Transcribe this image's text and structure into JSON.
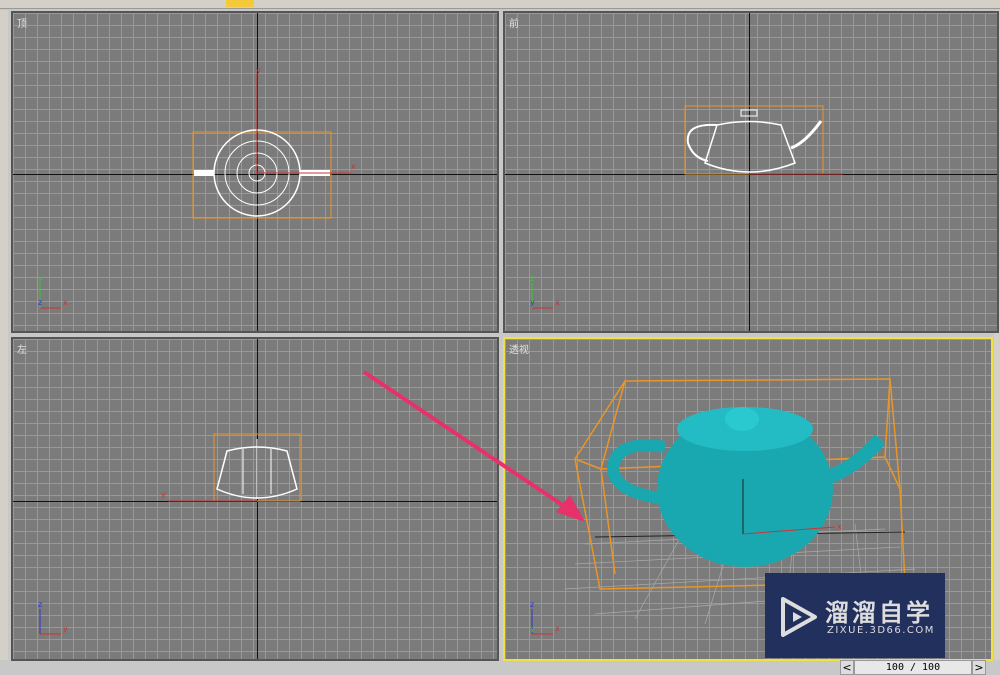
{
  "viewports": [
    {
      "label": "顶"
    },
    {
      "label": "前"
    },
    {
      "label": "左"
    },
    {
      "label": "透视"
    }
  ],
  "axes": {
    "x": "x",
    "y": "y",
    "z": "z"
  },
  "timeline": {
    "value": "100 / 100",
    "prev": "<",
    "next": ">"
  },
  "watermark": {
    "title": "溜溜自学",
    "url": "ZIXUE.3D66.COM"
  },
  "colors": {
    "teapot": "#1aa8b0",
    "selection": "#e8962a",
    "active_border": "#f0e040",
    "arrow": "#e8306a"
  }
}
